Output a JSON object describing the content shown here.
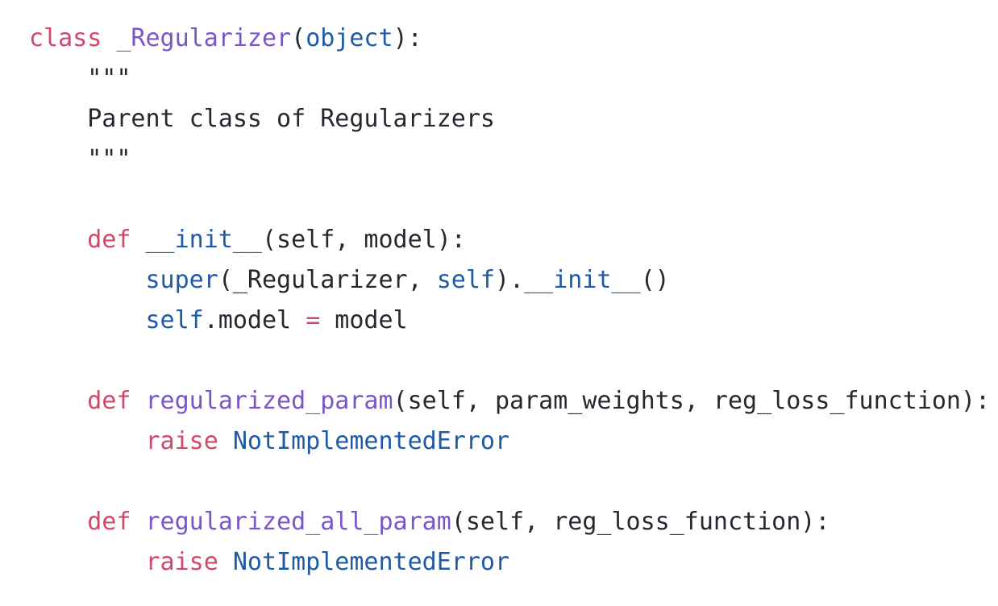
{
  "colors": {
    "keyword": "#cf4a6a",
    "class_or_function_name": "#7a55c9",
    "builtin": "#1f5aa6",
    "plain": "#24292f",
    "background": "#ffffff"
  },
  "code": {
    "language": "python",
    "lines": [
      [
        {
          "t": "class",
          "k": "keyword"
        },
        {
          "t": " ",
          "k": "text"
        },
        {
          "t": "_Regularizer",
          "k": "class"
        },
        {
          "t": "(",
          "k": "text"
        },
        {
          "t": "object",
          "k": "builtin"
        },
        {
          "t": "):",
          "k": "text"
        }
      ],
      [
        {
          "t": "    \"\"\"",
          "k": "string"
        }
      ],
      [
        {
          "t": "    Parent class of Regularizers",
          "k": "string"
        }
      ],
      [
        {
          "t": "    \"\"\"",
          "k": "string"
        }
      ],
      [],
      [
        {
          "t": "    ",
          "k": "text"
        },
        {
          "t": "def",
          "k": "keyword"
        },
        {
          "t": " ",
          "k": "text"
        },
        {
          "t": "__init__",
          "k": "builtin"
        },
        {
          "t": "(self, model):",
          "k": "text"
        }
      ],
      [
        {
          "t": "        ",
          "k": "text"
        },
        {
          "t": "super",
          "k": "builtin"
        },
        {
          "t": "(_Regularizer, ",
          "k": "text"
        },
        {
          "t": "self",
          "k": "builtin"
        },
        {
          "t": ").",
          "k": "text"
        },
        {
          "t": "__init__",
          "k": "builtin"
        },
        {
          "t": "()",
          "k": "text"
        }
      ],
      [
        {
          "t": "        ",
          "k": "text"
        },
        {
          "t": "self",
          "k": "builtin"
        },
        {
          "t": ".model ",
          "k": "text"
        },
        {
          "t": "=",
          "k": "keyword"
        },
        {
          "t": " model",
          "k": "text"
        }
      ],
      [],
      [
        {
          "t": "    ",
          "k": "text"
        },
        {
          "t": "def",
          "k": "keyword"
        },
        {
          "t": " ",
          "k": "text"
        },
        {
          "t": "regularized_param",
          "k": "class"
        },
        {
          "t": "(self, param_weights, reg_loss_function):",
          "k": "text"
        }
      ],
      [
        {
          "t": "        ",
          "k": "text"
        },
        {
          "t": "raise",
          "k": "keyword"
        },
        {
          "t": " ",
          "k": "text"
        },
        {
          "t": "NotImplementedError",
          "k": "builtin"
        }
      ],
      [],
      [
        {
          "t": "    ",
          "k": "text"
        },
        {
          "t": "def",
          "k": "keyword"
        },
        {
          "t": " ",
          "k": "text"
        },
        {
          "t": "regularized_all_param",
          "k": "class"
        },
        {
          "t": "(self, reg_loss_function):",
          "k": "text"
        }
      ],
      [
        {
          "t": "        ",
          "k": "text"
        },
        {
          "t": "raise",
          "k": "keyword"
        },
        {
          "t": " ",
          "k": "text"
        },
        {
          "t": "NotImplementedError",
          "k": "builtin"
        }
      ]
    ]
  }
}
